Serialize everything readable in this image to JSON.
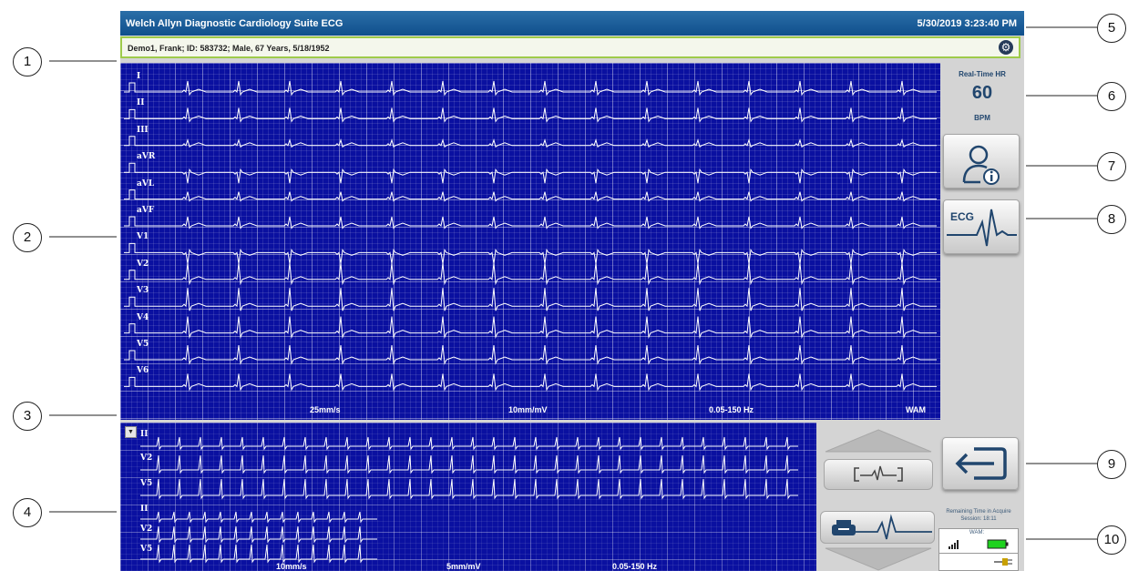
{
  "app": {
    "title": "Welch Allyn Diagnostic Cardiology Suite ECG",
    "datetime": "5/30/2019 3:23:40 PM"
  },
  "patient": {
    "info": "Demo1, Frank; ID: 583732; Male, 67 Years, 5/18/1952",
    "settings_icon": "gear-icon"
  },
  "main_ecg": {
    "leads": [
      "I",
      "II",
      "III",
      "aVR",
      "aVL",
      "aVF",
      "V1",
      "V2",
      "V3",
      "V4",
      "V5",
      "V6"
    ],
    "speed": "25mm/s",
    "gain": "10mm/mV",
    "filter": "0.05-150 Hz",
    "source": "WAM"
  },
  "rhythm_strip": {
    "leads_top": [
      "II",
      "V2",
      "V5"
    ],
    "leads_bottom": [
      "II",
      "V2",
      "V5"
    ],
    "speed": "10mm/s",
    "gain": "5mm/mV",
    "filter": "0.05-150 Hz"
  },
  "heart_rate": {
    "label": "Real-Time HR",
    "value": "60",
    "unit": "BPM"
  },
  "buttons": {
    "patient_info_icon": "patient-info-icon",
    "ecg_label": "ECG"
  },
  "status": {
    "remaining_line1": "Remaining Time in Acquire",
    "remaining_line2": "Session: 18:11",
    "wam_label": "WAM:"
  },
  "callouts": [
    "1",
    "2",
    "3",
    "4",
    "5",
    "6",
    "7",
    "8",
    "9",
    "10"
  ],
  "colors": {
    "title_bar": "#1a5c99",
    "ecg_background": "#0a10a0",
    "patient_bar_border": "#9ecb4a",
    "text_accent": "#21466e"
  }
}
